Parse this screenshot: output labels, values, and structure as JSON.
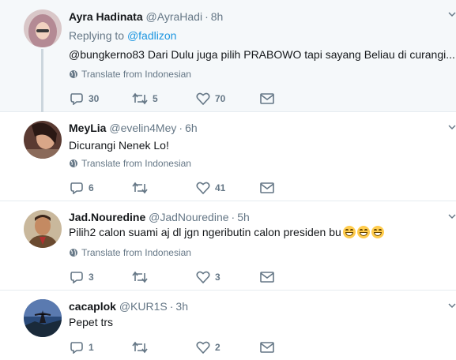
{
  "tweets": [
    {
      "name": "Ayra Hadinata",
      "handle": "@AyraHadi",
      "time": "8h",
      "replying_prefix": "Replying to",
      "replying_to": "@fadlizon",
      "text": "@bungkerno83 Dari Dulu juga pilih PRABOWO tapi sayang Beliau di curangi...",
      "translate": "Translate from Indonesian",
      "replies": "30",
      "retweets": "5",
      "likes": "70"
    },
    {
      "name": "MeyLia",
      "handle": "@evelin4Mey",
      "time": "6h",
      "text": "Dicurangi Nenek Lo!",
      "translate": "Translate from Indonesian",
      "replies": "6",
      "retweets": "",
      "likes": "41"
    },
    {
      "name": "Jad.Nouredine",
      "handle": "@JadNouredine",
      "time": "5h",
      "text": "Pilih2 calon suami aj dl jgn ngeributin calon presiden bu",
      "translate": "Translate from Indonesian",
      "replies": "3",
      "retweets": "",
      "likes": "3"
    },
    {
      "name": "cacaplok",
      "handle": "@KUR1S",
      "time": "3h",
      "text": "Pepet trs",
      "replies": "1",
      "retweets": "",
      "likes": "2"
    }
  ],
  "separator": "·",
  "icons": {
    "reply": "reply-icon",
    "retweet": "retweet-icon",
    "like": "heart-icon",
    "dm": "envelope-icon",
    "globe": "globe-icon",
    "more": "chevron-down-icon"
  },
  "colors": {
    "accent": "#1b95e0",
    "muted": "#657786",
    "highlight_bg": "#f5f8fa"
  }
}
